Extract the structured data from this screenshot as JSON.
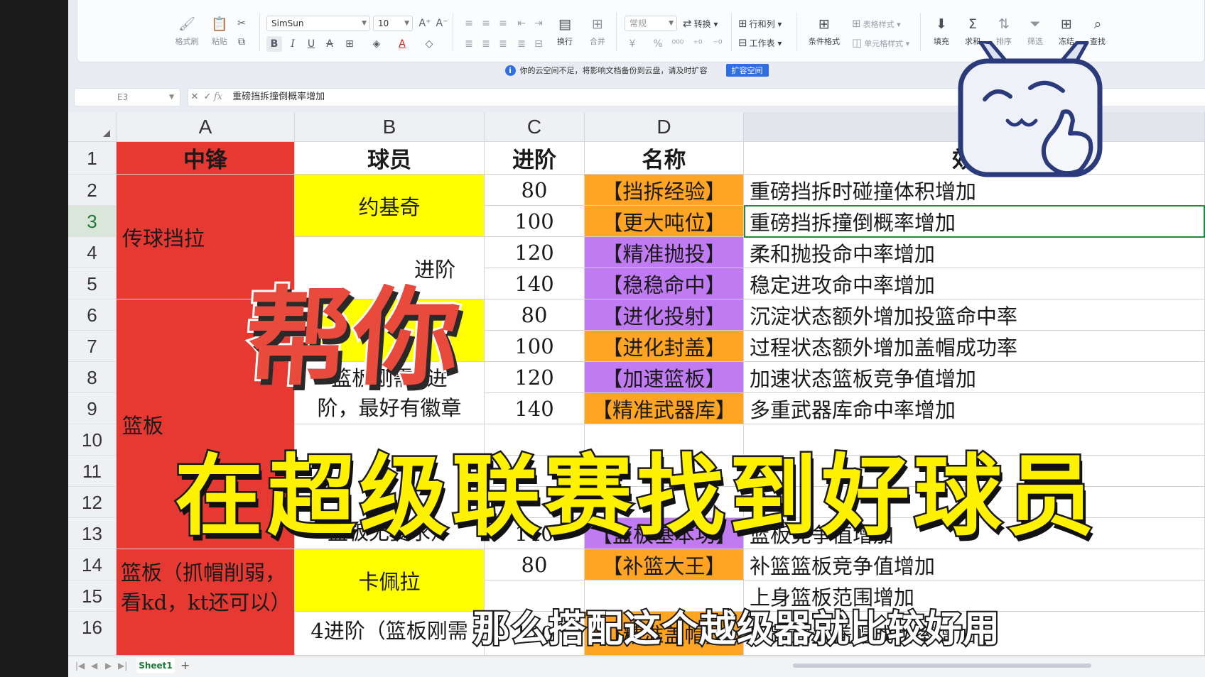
{
  "ribbon": {
    "format_painter": "格式刷",
    "paste": "粘贴",
    "font_name": "SimSun",
    "font_size": "10",
    "wrap": "换行",
    "merge": "合并",
    "number_format": "常规",
    "convert": "转换",
    "rows_cols": "行和列",
    "worksheet": "工作表",
    "conditional_format": "条件格式",
    "table_style": "表格样式",
    "cell_style": "单元格样式",
    "fill": "填充",
    "sum": "求和",
    "sort": "排序",
    "filter": "筛选",
    "freeze": "冻结",
    "find": "查找"
  },
  "infobar": {
    "message": "你的云空间不足，将影响文档备份到云盘，请及时扩容",
    "button": "扩容空间"
  },
  "formula_bar": {
    "cell_ref": "E3",
    "content": "重磅挡拆撞倒概率增加"
  },
  "columns": [
    "A",
    "B",
    "C",
    "D",
    "E"
  ],
  "rows": [
    "1",
    "2",
    "3",
    "4",
    "5",
    "6",
    "7",
    "8",
    "9",
    "10",
    "11",
    "12",
    "13",
    "14",
    "15",
    "16"
  ],
  "table": {
    "header": {
      "a": "中锋",
      "b": "球员",
      "c": "进阶",
      "d": "名称",
      "e": "效果"
    },
    "a_groups": [
      "传球挡拉",
      "篮板",
      "篮板（抓帽削弱，看kd，kt还可以）"
    ],
    "b_groups": [
      "约基奇",
      "进阶",
      "篮板刚需3进阶，最好有徽章",
      "篮板无要求）",
      "卡佩拉",
      "4进阶（篮板刚需"
    ],
    "c_values": [
      "80",
      "100",
      "120",
      "140",
      "80",
      "100",
      "120",
      "140",
      "",
      "",
      "",
      "140",
      "80",
      "",
      "120"
    ],
    "d_values": [
      "【挡拆经验】",
      "【更大吨位】",
      "【精准抛投】",
      "【稳稳命中】",
      "【进化投射】",
      "【进化封盖】",
      "【加速篮板】",
      "【精准武器库】",
      "",
      "",
      "",
      "【篮板基本功】",
      "【补篮大王】",
      "",
      "【精准盖帽】"
    ],
    "e_values": [
      "重磅挡拆时碰撞体积增加",
      "重磅挡拆撞倒概率增加",
      "柔和抛投命中率增加",
      "稳定进攻命中率增加",
      "沉淀状态额外增加投篮命中率",
      "过程状态额外增加盖帽成功率",
      "加速状态篮板竞争值增加",
      "多重武器库命中率增加",
      "",
      "",
      "",
      "篮板竞争值增加",
      "补篮篮板竞争值增加",
      "上身篮板范围增加",
      "下蹲到盖盖帽成功率增加"
    ]
  },
  "sheet_tab": "Sheet1",
  "overlay": {
    "line1": "帮你",
    "line2": "在超级联赛找到好球员",
    "subtitle": "那么搭配这个越级器就比较好用"
  },
  "colors": {
    "red": "#e53932",
    "yellow": "#ffff00",
    "orange": "#ffa523",
    "purple": "#c07bf2",
    "accent": "#2f6ee0"
  }
}
